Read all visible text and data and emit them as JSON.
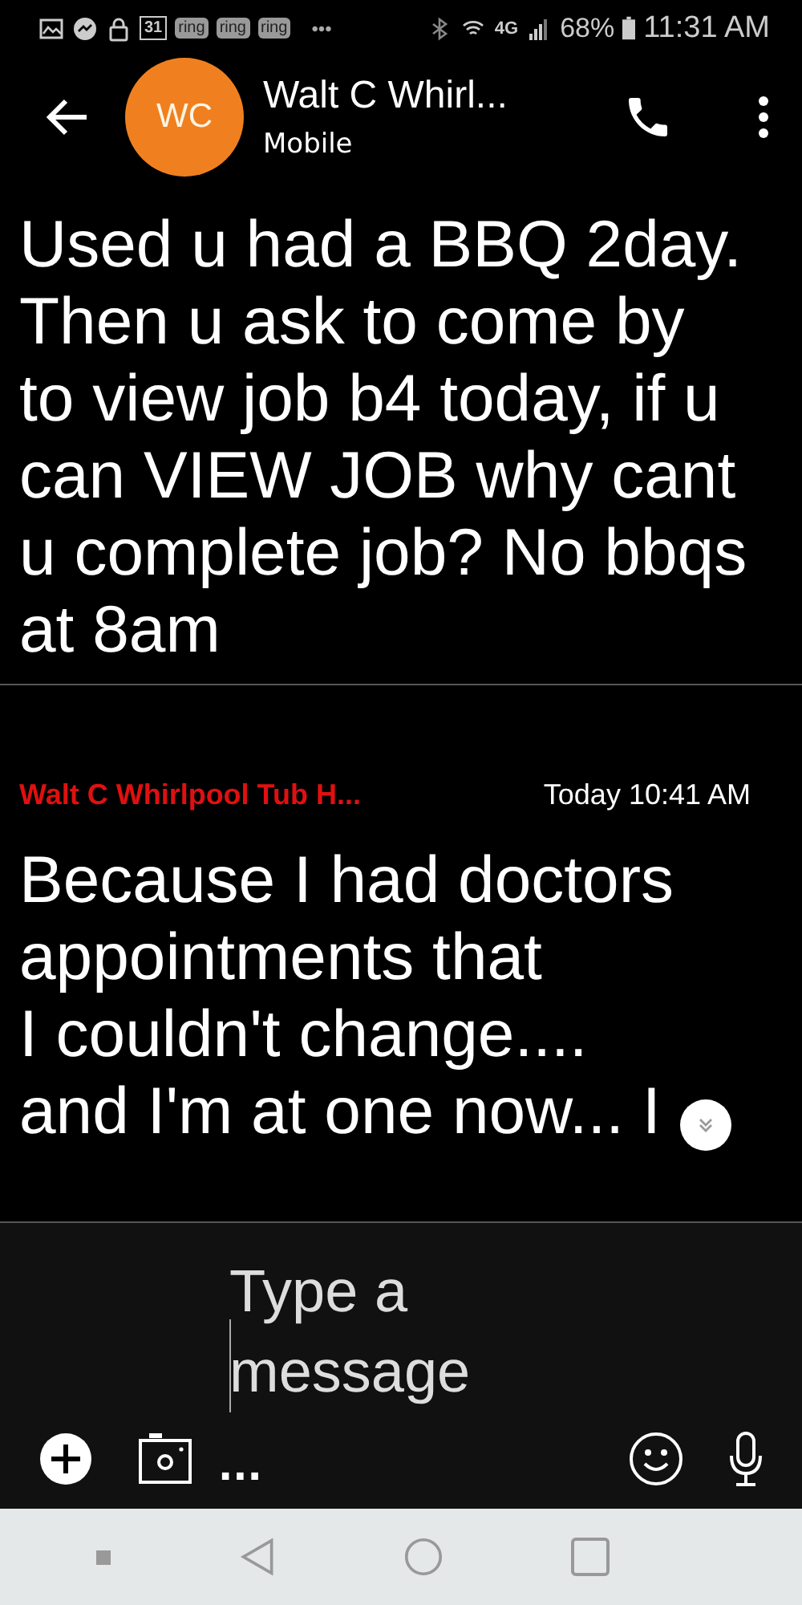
{
  "status_bar": {
    "calendar_day": "31",
    "ring_badges": [
      "ring",
      "ring",
      "ring"
    ],
    "more": "•••",
    "network": "4G",
    "battery": "68%",
    "time": "11:31 AM"
  },
  "header": {
    "avatar_initials": "WC",
    "name": "Walt C Whirl...",
    "subtitle": "Mobile"
  },
  "messages": [
    {
      "text": "Used u had a BBQ 2day.\nThen u ask to come by\nto view job b4 today, if u\ncan VIEW JOB why cant\nu complete job? No bbqs\nat 8am"
    },
    {
      "sender": "Walt C Whirlpool Tub H...",
      "time": "Today 10:41 AM",
      "text": "Because I had doctors\nappointments that\nI couldn't change....\nand I'm at one now... I"
    }
  ],
  "composer": {
    "placeholder": "Type a message",
    "more": "..."
  }
}
